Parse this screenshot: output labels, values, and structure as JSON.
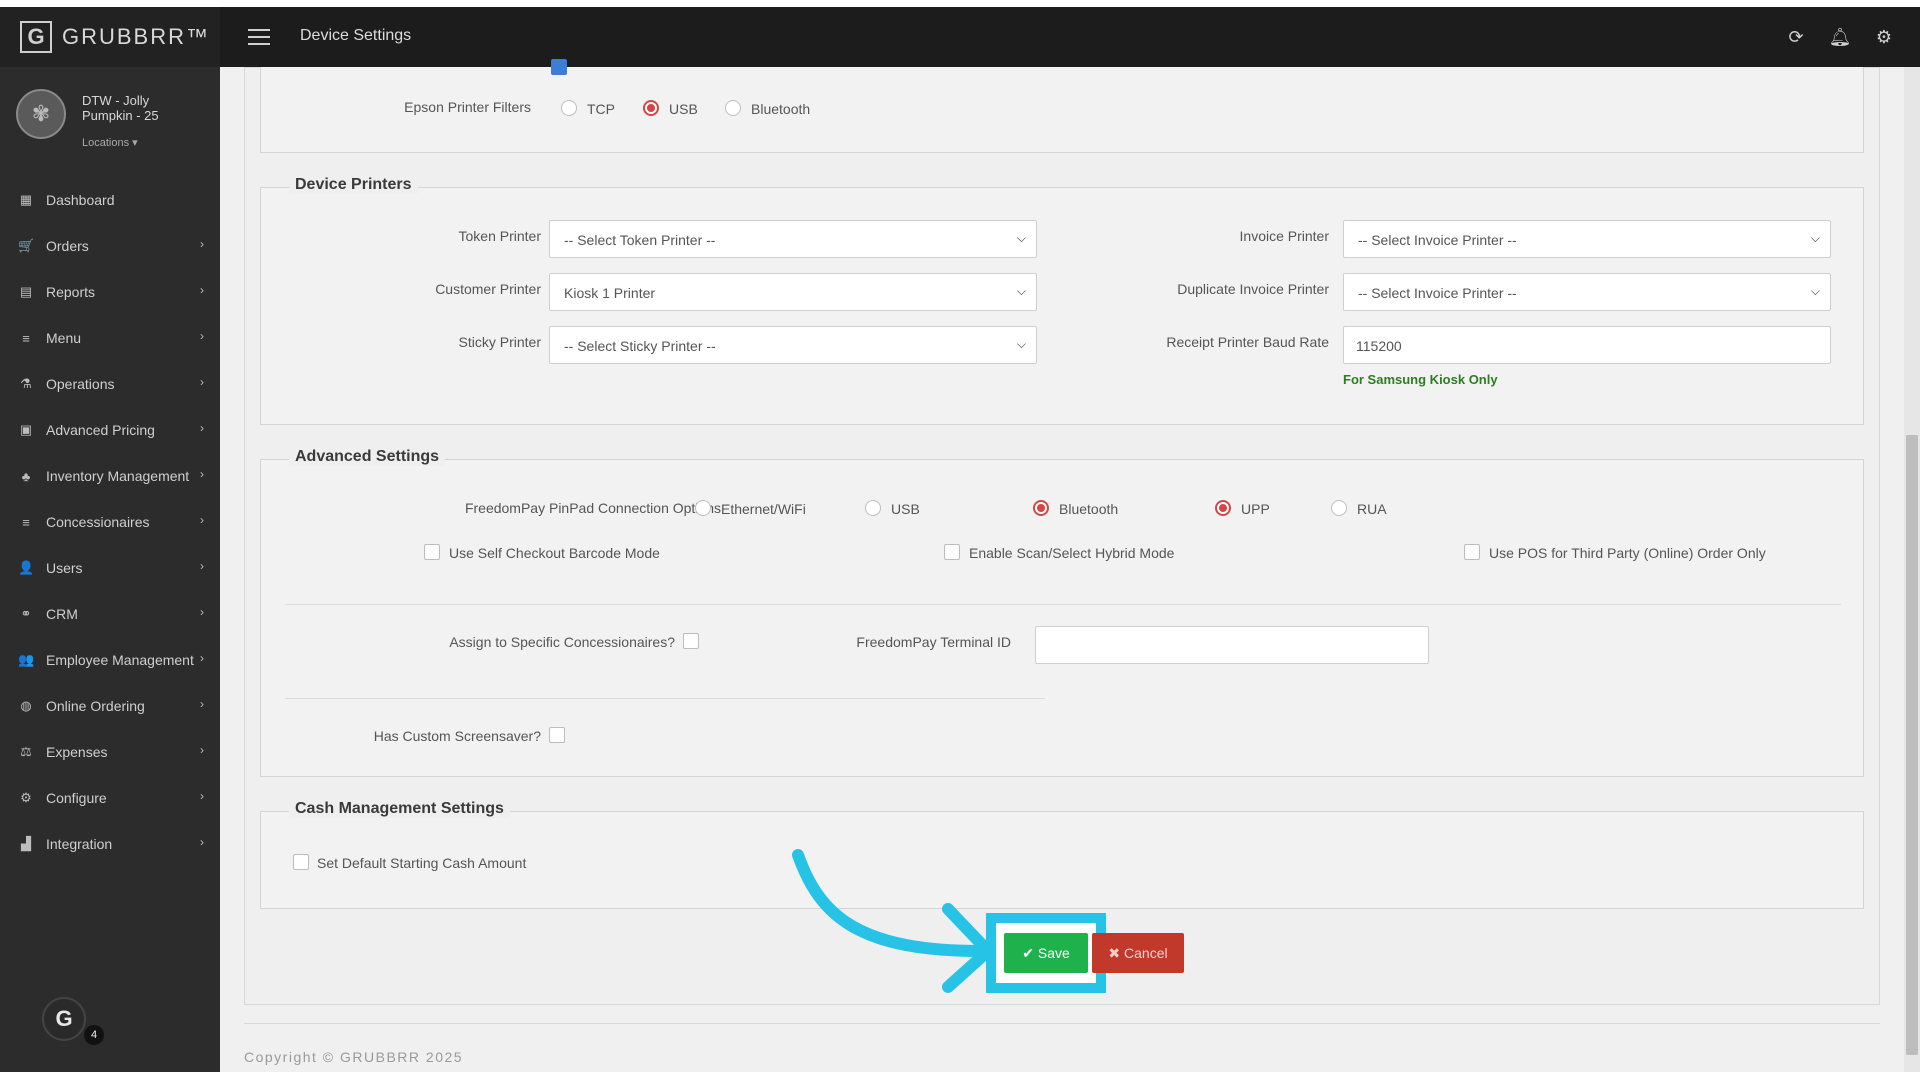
{
  "brand": {
    "mark": "G",
    "name": "GRUBBRR™"
  },
  "header": {
    "title": "Device Settings"
  },
  "profile": {
    "name": "DTW - Jolly Pumpkin - 25",
    "locations_label": "Locations ▾"
  },
  "sidebar": {
    "items": [
      {
        "label": "Dashboard",
        "icon": "dashboard-icon",
        "glyph": "▦",
        "chevron": false
      },
      {
        "label": "Orders",
        "icon": "cart-icon",
        "glyph": "🛒",
        "chevron": true
      },
      {
        "label": "Reports",
        "icon": "report-icon",
        "glyph": "▤",
        "chevron": true
      },
      {
        "label": "Menu",
        "icon": "list-icon",
        "glyph": "≡",
        "chevron": true
      },
      {
        "label": "Operations",
        "icon": "flask-icon",
        "glyph": "⚗",
        "chevron": true
      },
      {
        "label": "Advanced Pricing",
        "icon": "money-icon",
        "glyph": "▣",
        "chevron": true
      },
      {
        "label": "Inventory Management",
        "icon": "sitemap-icon",
        "glyph": "♣",
        "chevron": true
      },
      {
        "label": "Concessionaires",
        "icon": "list-icon",
        "glyph": "≡",
        "chevron": true
      },
      {
        "label": "Users",
        "icon": "user-plus-icon",
        "glyph": "👤",
        "chevron": true
      },
      {
        "label": "CRM",
        "icon": "link-icon",
        "glyph": "⚭",
        "chevron": true
      },
      {
        "label": "Employee Management",
        "icon": "users-icon",
        "glyph": "👥",
        "chevron": true
      },
      {
        "label": "Online Ordering",
        "icon": "globe-icon",
        "glyph": "◍",
        "chevron": true
      },
      {
        "label": "Expenses",
        "icon": "scale-icon",
        "glyph": "⚖",
        "chevron": true
      },
      {
        "label": "Configure",
        "icon": "gear-icon",
        "glyph": "⚙",
        "chevron": true
      },
      {
        "label": "Integration",
        "icon": "chart-icon",
        "glyph": "▟",
        "chevron": true
      }
    ],
    "chevron_glyph": "›"
  },
  "g_widget": {
    "letter": "G",
    "count": "4"
  },
  "epson": {
    "label": "Epson Printer Filters",
    "options": [
      {
        "label": "TCP",
        "selected": false
      },
      {
        "label": "USB",
        "selected": true
      },
      {
        "label": "Bluetooth",
        "selected": false
      }
    ]
  },
  "device_printers": {
    "title": "Device Printers",
    "token_printer": {
      "label": "Token Printer",
      "value": "-- Select Token Printer --"
    },
    "customer_printer": {
      "label": "Customer Printer",
      "value": "Kiosk 1 Printer"
    },
    "sticky_printer": {
      "label": "Sticky Printer",
      "value": "-- Select Sticky Printer --"
    },
    "invoice_printer": {
      "label": "Invoice Printer",
      "value": "-- Select Invoice Printer --"
    },
    "duplicate_invoice_printer": {
      "label": "Duplicate Invoice Printer",
      "value": "-- Select Invoice Printer --"
    },
    "baud_rate": {
      "label": "Receipt Printer Baud Rate",
      "value": "115200"
    },
    "samsung_note": "For Samsung Kiosk Only"
  },
  "advanced": {
    "title": "Advanced Settings",
    "pinpad_label": "FreedomPay PinPad Connection Options",
    "pinpad_options": [
      {
        "label": "Ethernet/WiFi",
        "selected": false
      },
      {
        "label": "USB",
        "selected": false
      },
      {
        "label": "Bluetooth",
        "selected": true
      },
      {
        "label": "UPP",
        "selected": true
      },
      {
        "label": "RUA",
        "selected": false
      }
    ],
    "self_checkout": "Use Self Checkout Barcode Mode",
    "hybrid_mode": "Enable Scan/Select Hybrid Mode",
    "pos_third_party": "Use POS for Third Party (Online) Order Only",
    "assign_concessionaires": "Assign to Specific Concessionaires?",
    "terminal_id_label": "FreedomPay Terminal ID",
    "terminal_id_value": "",
    "custom_screensaver": "Has Custom Screensaver?"
  },
  "cash": {
    "title": "Cash Management Settings",
    "default_cash": "Set Default Starting Cash Amount"
  },
  "actions": {
    "save": "✔ Save",
    "cancel": "✖ Cancel"
  },
  "footer": {
    "copyright": "Copyright © GRUBBRR 2025"
  },
  "colors": {
    "accent_highlight": "#27c3e6",
    "save_green": "#1fb14b",
    "cancel_red": "#c0392b",
    "radio_red": "#d64545"
  }
}
